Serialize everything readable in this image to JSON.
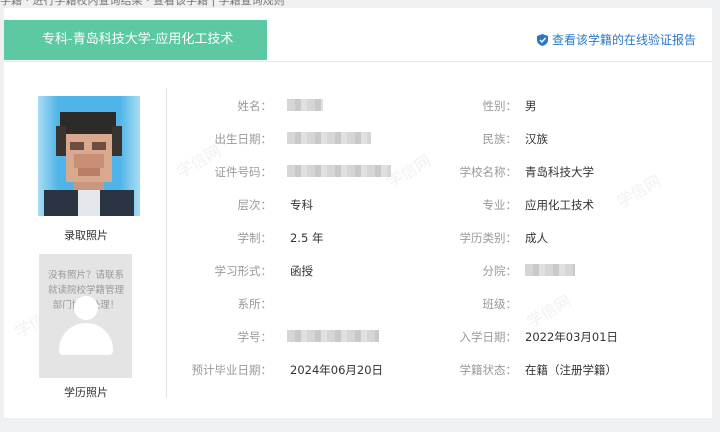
{
  "header": {
    "program_tag": "专科-青岛科技大学-应用化工技术",
    "verify_link": "查看该学籍的在线验证报告",
    "top_crumb": "学籍 · 进行学籍校内查询结果 · 查看该学籍 | 学籍查询规则"
  },
  "photos": {
    "admission_photo_label": "录取照片",
    "education_photo_label": "学历照片",
    "no_photo_text": "没有照片？请联系就读院校学籍管理部门协助处理！"
  },
  "fields_left": [
    {
      "label": "姓名：",
      "value": ""
    },
    {
      "label": "出生日期：",
      "value": ""
    },
    {
      "label": "证件号码：",
      "value": ""
    },
    {
      "label": "层次：",
      "value": "专科"
    },
    {
      "label": "学制：",
      "value": "2.5 年"
    },
    {
      "label": "学习形式：",
      "value": "函授"
    },
    {
      "label": "系所：",
      "value": ""
    },
    {
      "label": "学号：",
      "value": ""
    },
    {
      "label": "预计毕业日期：",
      "value": "2024年06月20日"
    }
  ],
  "fields_right": [
    {
      "label": "性别：",
      "value": "男"
    },
    {
      "label": "民族：",
      "value": "汉族"
    },
    {
      "label": "学校名称：",
      "value": "青岛科技大学"
    },
    {
      "label": "专业：",
      "value": "应用化工技术"
    },
    {
      "label": "学历类别：",
      "value": "成人"
    },
    {
      "label": "分院：",
      "value": ""
    },
    {
      "label": "班级：",
      "value": ""
    },
    {
      "label": "入学日期：",
      "value": "2022年03月01日"
    },
    {
      "label": "学籍状态：",
      "value": "在籍（注册学籍）"
    }
  ],
  "watermark": "学信网",
  "colors": {
    "tag_bg": "#5cc9a3",
    "link": "#2a77c9",
    "photo_bg": "#4fb4e7"
  }
}
